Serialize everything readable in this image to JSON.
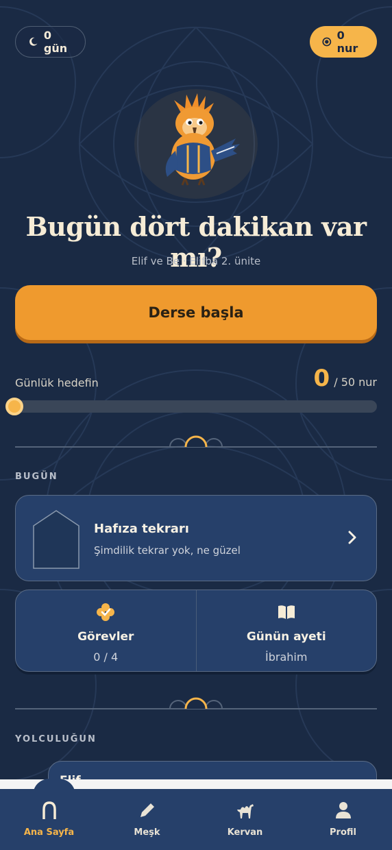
{
  "status": {
    "streak_label": "0 gün",
    "nur_label": "0 nur"
  },
  "hero": {
    "headline": "Bugün dört dakikan var mı?",
    "subline": "Elif ve Be · Elifba 2. ünite",
    "start_label": "Derse başla"
  },
  "goal": {
    "label": "Günlük hedefin",
    "current": "0",
    "target_label": "/ 50 nur",
    "progress_fraction": 0
  },
  "today": {
    "section_title": "BUGÜN",
    "review": {
      "title": "Hafıza tekrarı",
      "subtitle": "Şimdilik tekrar yok, ne güzel"
    },
    "tasks": {
      "title": "Görevler",
      "value": "0 / 4",
      "icon": "clover-icon"
    },
    "verse": {
      "title": "Günün ayeti",
      "value": "İbrahim",
      "icon": "open-book-icon"
    }
  },
  "journey": {
    "section_title": "YOLCULUĞUN",
    "card_label": "Elif"
  },
  "tabs": [
    {
      "label": "Ana Sayfa",
      "icon": "arch-icon",
      "active": true
    },
    {
      "label": "Meşk",
      "icon": "pencil-icon",
      "active": false
    },
    {
      "label": "Kervan",
      "icon": "camel-icon",
      "active": false
    },
    {
      "label": "Profil",
      "icon": "person-icon",
      "active": false
    }
  ],
  "colors": {
    "background": "#1a2a44",
    "card": "#26406a",
    "accent": "#f6b54a",
    "button": "#ef9a2e"
  }
}
